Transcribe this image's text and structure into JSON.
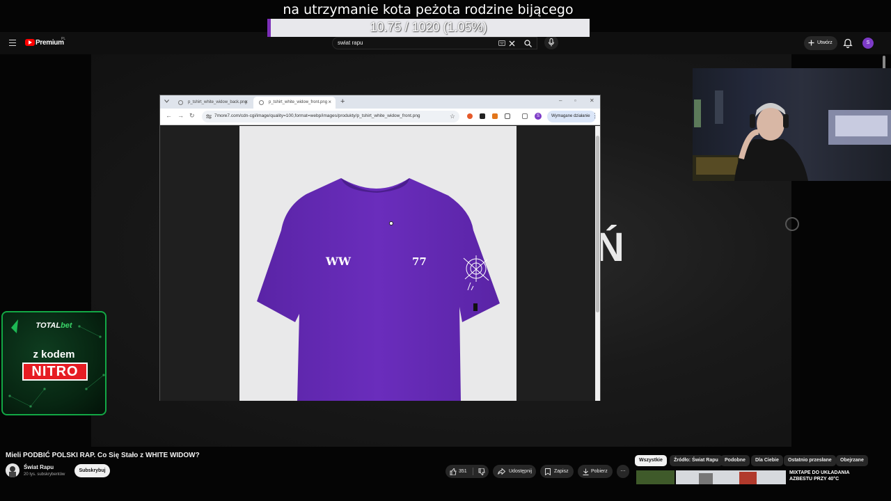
{
  "donation": {
    "title": "na utrzymanie kota peżota rodzine bijącego",
    "progress_text": "10.75 / 1020 (1.05%)",
    "progress_fraction": 0.0105,
    "fill_color": "#7c2fb8"
  },
  "youtube_header": {
    "logo_label": "Premium",
    "country": "PL",
    "search_value": "swiat rapu",
    "create_label": "Utwórz",
    "avatar_letter": "S"
  },
  "browser": {
    "tab_inactive": "p_tshirt_white_widow_back.png",
    "tab_active": "p_tshirt_white_widow_front.png",
    "url": "7more7.com/cdn-cgi/image/quality=100,format=webp/images/produkty/p_tshirt_white_widow_front.png",
    "action_required": "Wymagane działanie",
    "profile_letter": "S",
    "shirt_color": "#6a2dbc",
    "shirt_print_left": "WW",
    "shirt_print_right": "77"
  },
  "background_letter": "Ń",
  "ad": {
    "brand_a": "TOTAL",
    "brand_b": "bet",
    "line1": "z kodem",
    "code": "NITRO"
  },
  "video": {
    "title": "Mieli PODBIĆ POLSKI RAP. Co Się Stało z WHITE WIDOW?",
    "channel_name": "Świat Rapu",
    "subscribers": "20 tys. subskrybentów",
    "subscribe_label": "Subskrybuj",
    "likes": "351",
    "share_label": "Udostępnij",
    "save_label": "Zapisz",
    "download_label": "Pobierz"
  },
  "chips": [
    {
      "label": "Wszystkie",
      "selected": true
    },
    {
      "label": "Źródło: Świat Rapu",
      "selected": false
    },
    {
      "label": "Podobne",
      "selected": false
    },
    {
      "label": "Dla Ciebie",
      "selected": false
    },
    {
      "label": "Ostatnio przesłane",
      "selected": false
    },
    {
      "label": "Obejrzane",
      "selected": false
    }
  ],
  "recommendation": {
    "title_line1": "MIXTAPE DO UKŁADANIA",
    "title_line2": "AZBESTU PRZY 40°C"
  }
}
